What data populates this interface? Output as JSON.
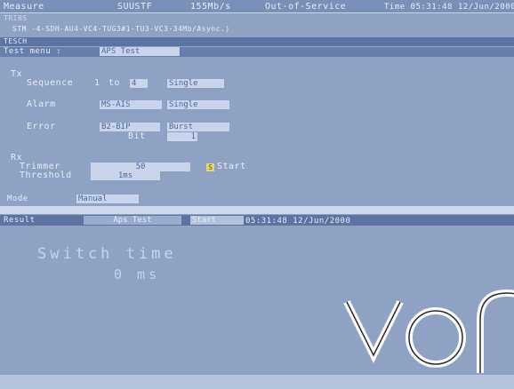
{
  "status_bar": {
    "mode": "Measure",
    "device": "SUUSTF",
    "rate": "155Mb/s",
    "service": "Out-of-Service",
    "time": "Time 05:31:48 12/Jun/2000"
  },
  "header": {
    "label": "TRIBS",
    "path": "STM -4-SDH-AU4-VC4-TUG3#1-TU3-VC3-34Mb/Async.)",
    "section": "TESCH"
  },
  "test_menu": {
    "label": "Test menu :",
    "selected": "APS Test"
  },
  "tx": {
    "heading": "Tx",
    "sequence_label": "Sequence",
    "sequence_from": "1",
    "sequence_to_label": "to",
    "sequence_to": "4",
    "sequence_mode": "Single",
    "alarm_label": "Alarm",
    "alarm_value": "MS-AIS",
    "alarm_mode": "Single",
    "error_label": "Error",
    "error_value": "B2-BIP",
    "error_mode": "Burst",
    "bit_label": "Bit",
    "bit_value": "1"
  },
  "rx": {
    "heading": "Rx",
    "trimmer_label": "Trimmer",
    "trimmer_value": "50",
    "start_label": "Start",
    "threshold_label": "Threshold",
    "threshold_value": "1ms"
  },
  "mode": {
    "label": "Mode",
    "value": "Manual"
  },
  "result_bar": {
    "label": "Result",
    "test": "Aps Test",
    "state": "Start",
    "timestamp": "05:31:48 12/Jun/2000"
  },
  "result": {
    "title": "Switch time",
    "value": "0 ms"
  },
  "colors": {
    "screen_bg": "#8fa2c4",
    "bar_bg": "#5d73a3",
    "highlight": "#e8d86a"
  }
}
